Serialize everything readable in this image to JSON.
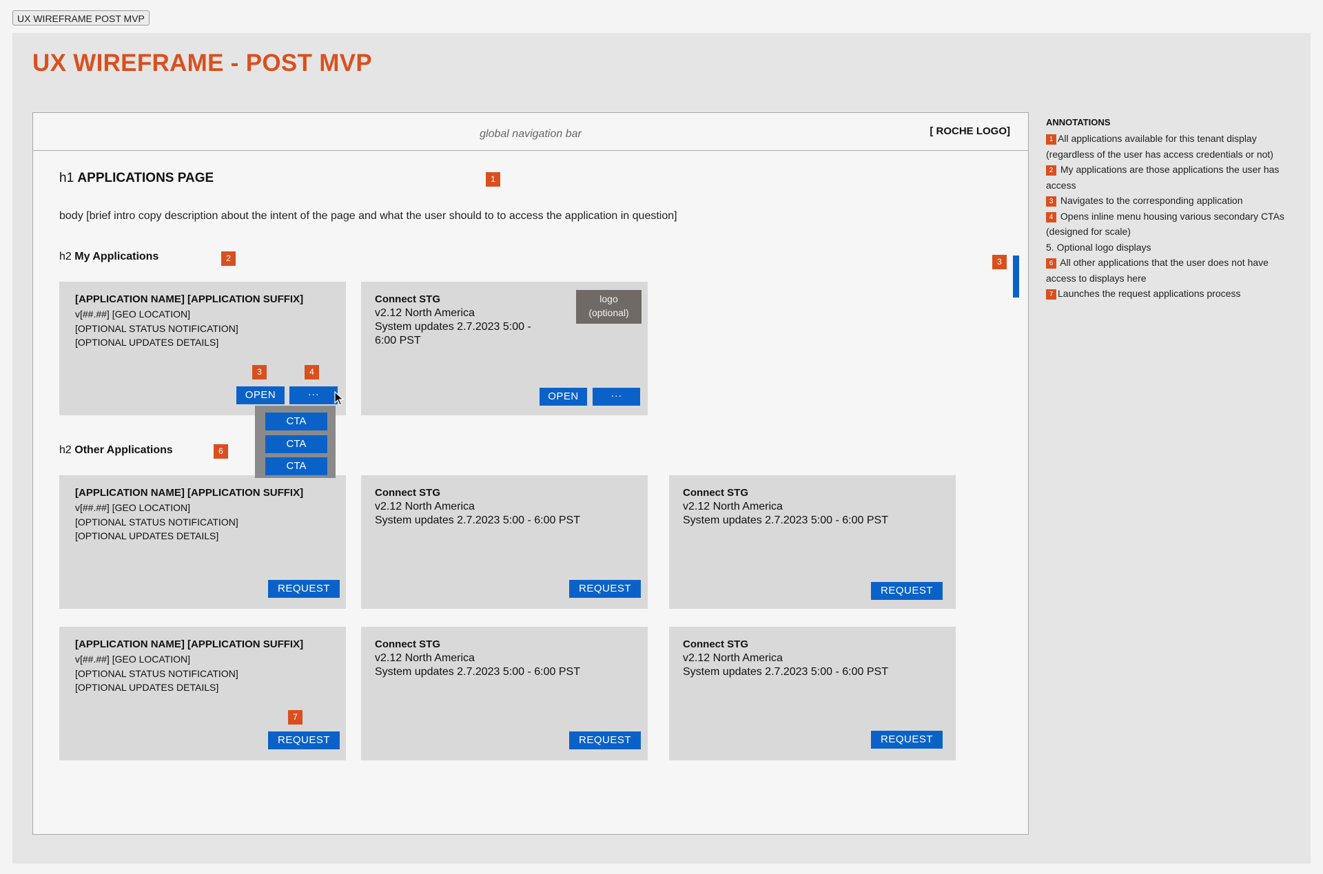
{
  "frame_tab": "UX WIREFRAME POST MVP",
  "title": "UX WIREFRAME - POST MVP",
  "nav": {
    "text": "global navigation bar",
    "logo": "[ ROCHE LOGO]"
  },
  "h1": {
    "prefix": "h1",
    "text": "APPLICATIONS PAGE"
  },
  "body_copy": "body [brief intro copy description about the intent of the page and what the user should to to access the application in question]",
  "my_apps": {
    "prefix": "h2",
    "heading": "My Applications",
    "card1": {
      "title": "[APPLICATION NAME] [APPLICATION SUFFIX]",
      "lines": [
        "v[##.##] [GEO LOCATION]",
        "[OPTIONAL STATUS NOTIFICATION]",
        "[OPTIONAL UPDATES DETAILS]"
      ],
      "open": "OPEN",
      "more": "···"
    },
    "card2": {
      "title": "Connect STG",
      "line1": "v2.12 North America",
      "line2": "System updates 2.7.2023 5:00 -",
      "line3": "6:00 PST",
      "logo_line1": "logo",
      "logo_line2": "(optional)",
      "open": "OPEN",
      "more": "···"
    },
    "menu": [
      "CTA",
      "CTA",
      "CTA"
    ]
  },
  "other_apps": {
    "prefix": "h2",
    "heading": "Other Applications",
    "placeholder_card": {
      "title": "[APPLICATION NAME] [APPLICATION SUFFIX]",
      "lines": [
        "v[##.##] [GEO LOCATION]",
        "[OPTIONAL STATUS NOTIFICATION]",
        "[OPTIONAL UPDATES DETAILS]"
      ]
    },
    "stg_card": {
      "title": "Connect STG",
      "line1": "v2.12 North America",
      "line2": "System updates 2.7.2023 5:00 - 6:00 PST"
    },
    "request": "REQUEST"
  },
  "markers": [
    "1",
    "2",
    "3",
    "4",
    "6",
    "7",
    "3"
  ],
  "annotations": {
    "title": "ANNOTATIONS",
    "items": [
      {
        "num": "1",
        "text": "All applications available for this tenant display (regardless of the user has access credentials or not)"
      },
      {
        "num": "2",
        "text": "My applications are those applications the user has access"
      },
      {
        "num": "3",
        "text": "Navigates to the corresponding application"
      },
      {
        "num": "4",
        "text": "Opens inline menu housing various secondary CTAs (designed for scale)"
      },
      {
        "num": "",
        "text": "5. Optional logo displays"
      },
      {
        "num": "6",
        "text": "All other applications that the user does not have access to displays here"
      },
      {
        "num": "7",
        "text": "Launches the request applications process"
      }
    ]
  },
  "colors": {
    "accent": "#d9501e",
    "button": "#0a62c9",
    "card": "#d9d9d9",
    "canvas": "#e5e5e5"
  }
}
